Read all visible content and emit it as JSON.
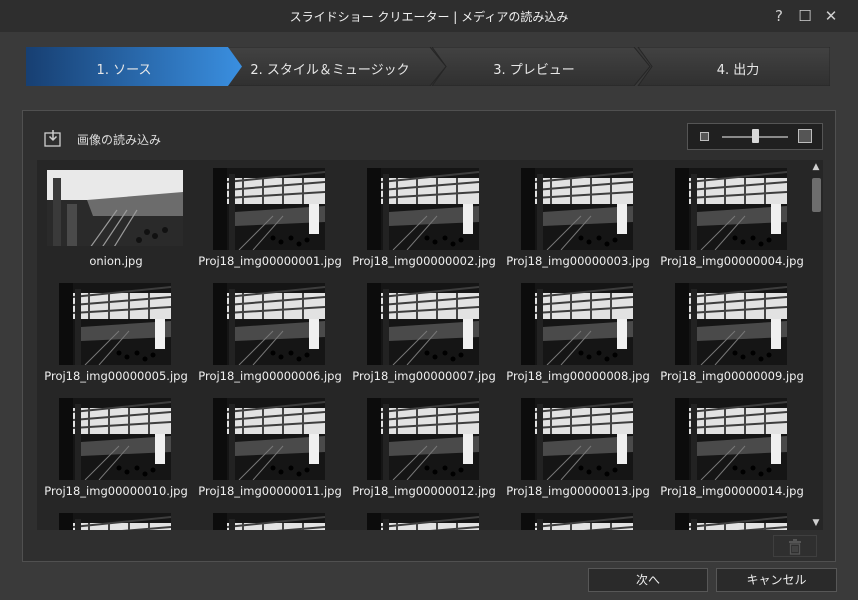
{
  "window": {
    "title": "スライドショー クリエーター | メディアの読み込み",
    "help": "?",
    "maximize": "☐",
    "close": "✕"
  },
  "steps": [
    {
      "label": "1. ソース",
      "active": true
    },
    {
      "label": "2. スタイル＆ミュージック",
      "active": false
    },
    {
      "label": "3. プレビュー",
      "active": false
    },
    {
      "label": "4. 出力",
      "active": false
    }
  ],
  "toolbar": {
    "import_label": "画像の読み込み",
    "zoom_level": 0.45
  },
  "files": [
    "onion.jpg",
    "Proj18_img00000001.jpg",
    "Proj18_img00000002.jpg",
    "Proj18_img00000003.jpg",
    "Proj18_img00000004.jpg",
    "Proj18_img00000005.jpg",
    "Proj18_img00000006.jpg",
    "Proj18_img00000007.jpg",
    "Proj18_img00000008.jpg",
    "Proj18_img00000009.jpg",
    "Proj18_img00000010.jpg",
    "Proj18_img00000011.jpg",
    "Proj18_img00000012.jpg",
    "Proj18_img00000013.jpg",
    "Proj18_img00000014.jpg",
    "",
    "",
    "",
    "",
    ""
  ],
  "scroll": {
    "up": "▲",
    "down": "▼"
  },
  "footer": {
    "next_label": "次へ",
    "cancel_label": "キャンセル"
  },
  "colors": {
    "active_step": "#2f86d6",
    "inactive_step": "#3c3c3c"
  }
}
